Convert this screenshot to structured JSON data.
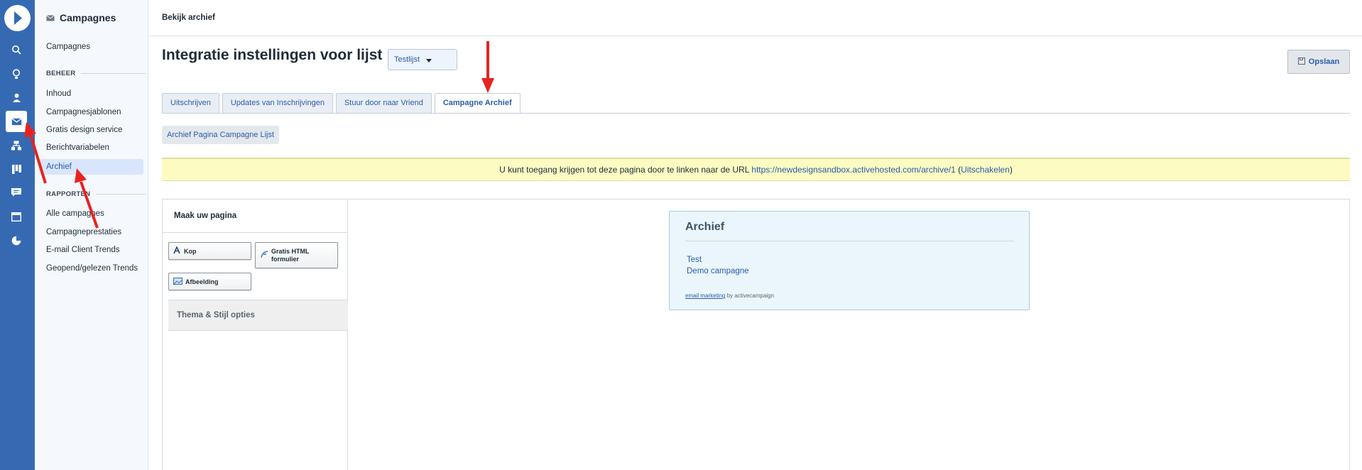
{
  "rail": {
    "icons": [
      "logo-icon",
      "search-icon",
      "lightbulb-icon",
      "contacts-icon",
      "campaigns-icon",
      "automations-icon",
      "deals-icon",
      "conversations-icon",
      "website-icon",
      "reports-icon"
    ]
  },
  "sidebar": {
    "title": "Campagnes",
    "top_item": "Campagnes",
    "section_beheer": "BEHEER",
    "beheer_items": [
      "Inhoud",
      "Campagnesjablonen",
      "Gratis design service",
      "Berichtvariabelen",
      "Archief"
    ],
    "section_rapporten": "RAPPORTEN",
    "rapporten_items": [
      "Alle campagnes",
      "Campagneprestaties",
      "E-mail Client Trends",
      "Geopend/gelezen Trends"
    ]
  },
  "topbar": {
    "breadcrumb": "Bekijk archief"
  },
  "page": {
    "title": "Integratie instellingen voor lijst",
    "list_select": "Testlijst",
    "save_label": "Opslaan"
  },
  "tabs": [
    "Uitschrijven",
    "Updates van Inschrijvingen",
    "Stuur door naar Vriend",
    "Campagne Archief"
  ],
  "subtab": "Archief Pagina Campagne Lijst",
  "notice": {
    "text": "U kunt toegang krijgen tot deze pagina door te linken naar de URL ",
    "url": "https://newdesignsandbox.activehosted.com/archive/1",
    "open_paren": " (",
    "disable": "Uitschakelen",
    "close_paren": ")"
  },
  "builder": {
    "heading": "Maak uw pagina",
    "widgets": [
      "Kop",
      "Gratis HTML formulier",
      "Afbeelding"
    ],
    "theme_options": "Thema & Stijl opties"
  },
  "preview": {
    "title": "Archief",
    "links": [
      "Test",
      "Demo campagne"
    ],
    "footer_link": "email marketing",
    "footer_text": " by activecampaign"
  },
  "colors": {
    "rail": "#356ab3",
    "accent": "#2a5cab",
    "notice": "#fbfbc2",
    "arrow": "#e8231f"
  }
}
